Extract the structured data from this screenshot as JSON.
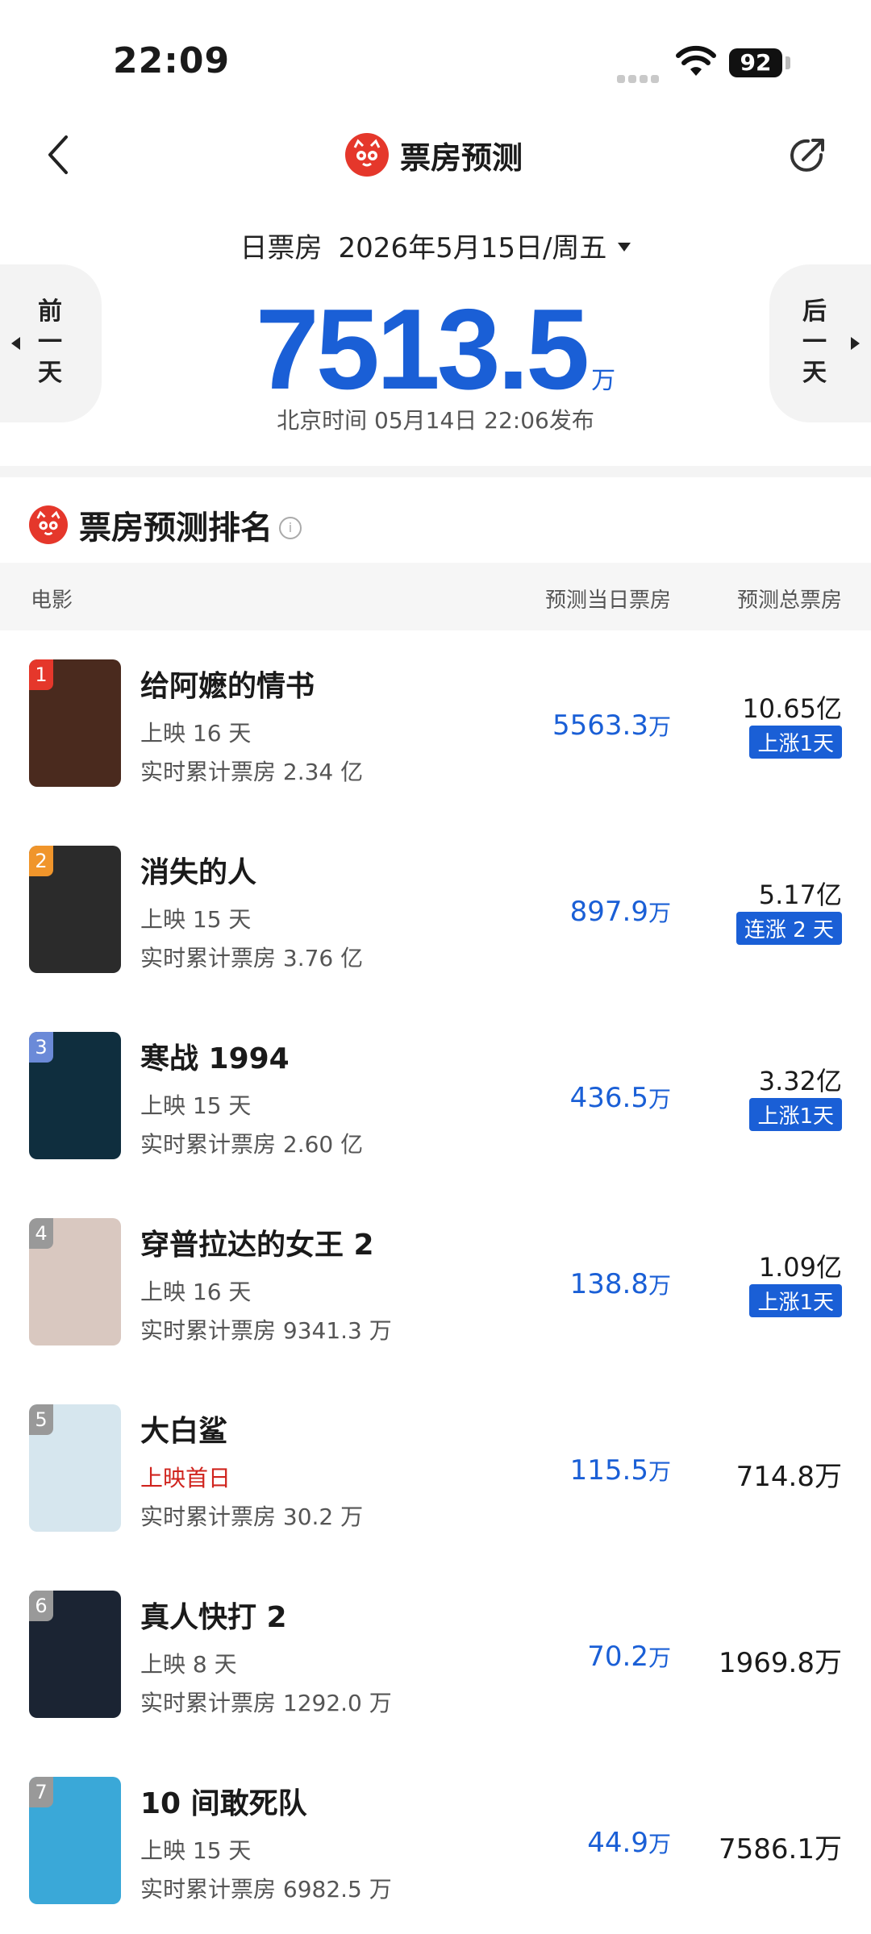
{
  "status_bar": {
    "time": "22:09",
    "battery": "92"
  },
  "nav": {
    "title": "票房预测"
  },
  "header": {
    "date_label": "日票房",
    "date_value": "2026年5月15日/周五",
    "prev_day": "前一天",
    "next_day": "后一天",
    "total_value": "7513.5",
    "total_unit": "万",
    "publish_note": "北京时间  05月14日  22:06发布"
  },
  "ranking": {
    "section_title": "票房预测排名",
    "col_movie": "电影",
    "col_today": "预测当日票房",
    "col_total": "预测总票房",
    "movies": [
      {
        "rank": "1",
        "title": "给阿嬷的情书",
        "days": "上映 16 天",
        "cumulative": "实时累计票房 2.34 亿",
        "today_value": "5563.3",
        "today_unit": "万",
        "total": "10.65亿",
        "trend": "上涨1天",
        "rank_color": "#e5372b",
        "poster_color": "#4a2a1e"
      },
      {
        "rank": "2",
        "title": "消失的人",
        "days": "上映 15 天",
        "cumulative": "实时累计票房 3.76 亿",
        "today_value": "897.9",
        "today_unit": "万",
        "total": "5.17亿",
        "trend": "连涨 2 天",
        "rank_color": "#f0952b",
        "poster_color": "#2b2b2b"
      },
      {
        "rank": "3",
        "title": "寒战 1994",
        "days": "上映 15 天",
        "cumulative": "实时累计票房 2.60 亿",
        "today_value": "436.5",
        "today_unit": "万",
        "total": "3.32亿",
        "trend": "上涨1天",
        "rank_color": "#6b8ad8",
        "poster_color": "#0f2e3e"
      },
      {
        "rank": "4",
        "title": "穿普拉达的女王 2",
        "days": "上映 16 天",
        "cumulative": "实时累计票房 9341.3 万",
        "today_value": "138.8",
        "today_unit": "万",
        "total": "1.09亿",
        "trend": "上涨1天",
        "rank_color": "#999999",
        "poster_color": "#d9c8c0"
      },
      {
        "rank": "5",
        "title": "大白鲨",
        "days": "上映首日",
        "days_red": true,
        "cumulative": "实时累计票房 30.2 万",
        "today_value": "115.5",
        "today_unit": "万",
        "total": "714.8万",
        "trend": "",
        "rank_color": "#999999",
        "poster_color": "#d6e6ee"
      },
      {
        "rank": "6",
        "title": "真人快打 2",
        "days": "上映 8 天",
        "cumulative": "实时累计票房 1292.0 万",
        "today_value": "70.2",
        "today_unit": "万",
        "total": "1969.8万",
        "trend": "",
        "rank_color": "#999999",
        "poster_color": "#1b2433"
      },
      {
        "rank": "7",
        "title": "10 间敢死队",
        "days": "上映 15 天",
        "cumulative": "实时累计票房 6982.5 万",
        "today_value": "44.9",
        "today_unit": "万",
        "total": "7586.1万",
        "trend": "",
        "rank_color": "#999999",
        "poster_color": "#3aa8d8"
      }
    ]
  }
}
